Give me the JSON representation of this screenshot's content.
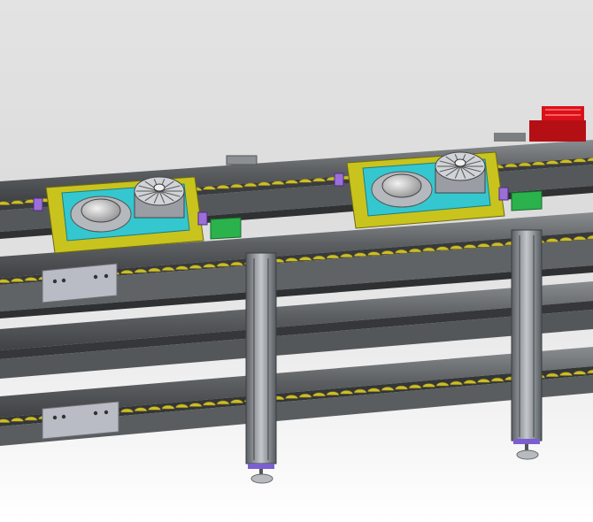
{
  "viewport": {
    "background_top": "#e3e3e3",
    "background_bottom": "#ffffff"
  },
  "model": {
    "parts": [
      {
        "name": "conveyor-line-top",
        "color": "#6f7275"
      },
      {
        "name": "conveyor-line-middle",
        "color": "#6f7275"
      },
      {
        "name": "conveyor-line-bottom",
        "color": "#6f7275"
      },
      {
        "name": "pallet-fixture-left",
        "color": "#c9c31e"
      },
      {
        "name": "pallet-fixture-right",
        "color": "#c9c31e"
      },
      {
        "name": "locating-plate",
        "color": "#35c7cf"
      },
      {
        "name": "support-leg",
        "color": "#9aa0a6"
      },
      {
        "name": "drive-motor",
        "color": "#d9121a"
      },
      {
        "name": "stop-sensor-bracket",
        "color": "#2bb24c"
      },
      {
        "name": "mounting-plate",
        "color": "#b9bcc4"
      }
    ],
    "roller_color": "#cbbd2a",
    "clamp_color": "#9b6fd6"
  }
}
